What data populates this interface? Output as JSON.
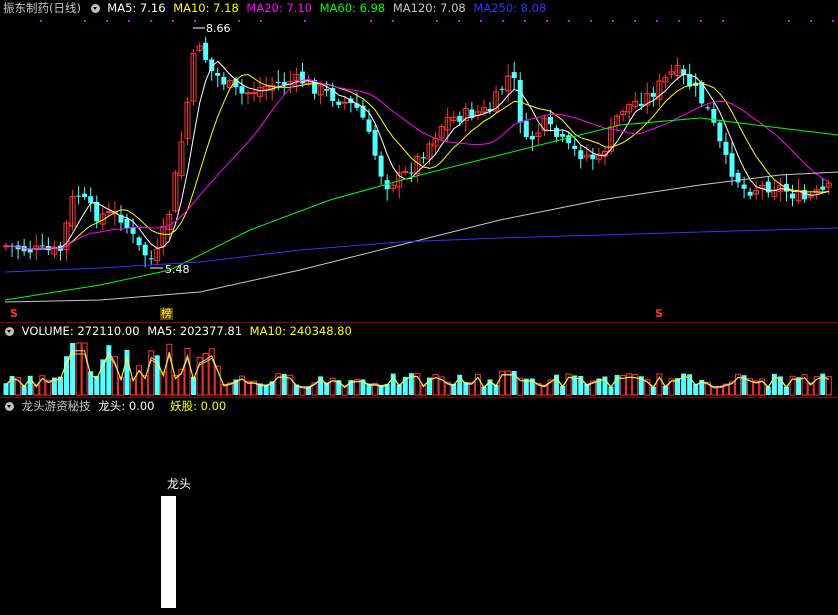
{
  "kline": {
    "title": "振东制药(日线)",
    "ma": [
      {
        "label": "MA5: 7.16",
        "color": "#ffffff"
      },
      {
        "label": "MA10: 7.18",
        "color": "#ffff00"
      },
      {
        "label": "MA20: 7.10",
        "color": "#ff00ff"
      },
      {
        "label": "MA60: 6.98",
        "color": "#00ff00"
      },
      {
        "label": "MA120: 7.08",
        "color": "#c8c8c8"
      },
      {
        "label": "MA250: 8.08",
        "color": "#3333ff"
      }
    ],
    "high_label": "8.66",
    "low_label": "5.48",
    "markers": [
      "S",
      "榜",
      "S"
    ]
  },
  "volume": {
    "label": "VOLUME: 272110.00",
    "ma5": "MA5: 202377.81",
    "ma10": "MA10: 240348.80"
  },
  "indicator": {
    "name": "龙头游资秘技",
    "longtou": "龙头: 0.00",
    "yaogu": "妖股: 0.00",
    "bar_label": "龙头"
  },
  "colors": {
    "up": "#ff3232",
    "down": "#54ffff",
    "separator": "#8b0000"
  }
}
